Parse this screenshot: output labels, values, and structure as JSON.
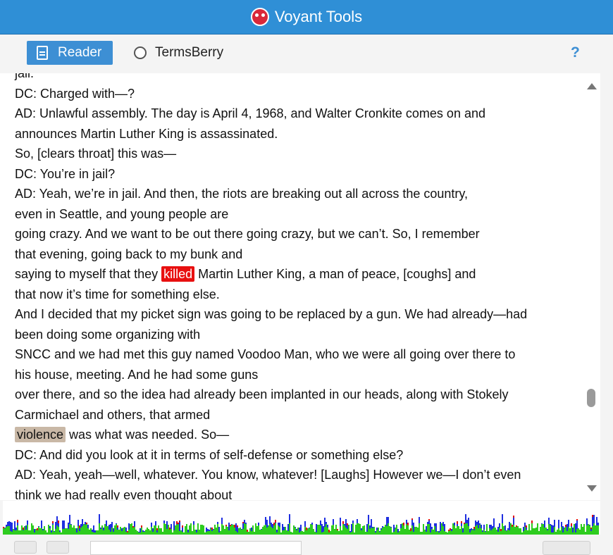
{
  "app": {
    "title": "Voyant Tools"
  },
  "toolbar": {
    "tabs": [
      {
        "label": "Reader",
        "active": true
      },
      {
        "label": "TermsBerry",
        "active": false
      }
    ],
    "help_label": "?"
  },
  "reader": {
    "lines": [
      [
        "jail."
      ],
      [
        "DC: Charged with—?"
      ],
      [
        "AD: Unlawful assembly. The day is April 4, 1968, and Walter Cronkite comes on and"
      ],
      [
        "announces Martin Luther King is assassinated."
      ],
      [
        "So, [clears throat] this was—"
      ],
      [
        "DC: You’re in jail?"
      ],
      [
        "AD: Yeah, we’re in jail. And then, the riots are breaking out all across the country,"
      ],
      [
        "even in Seattle, and young people are"
      ],
      [
        "going crazy. And we want to be out there going crazy, but we can’t. So, I remember"
      ],
      [
        "that evening, going back to my bunk and"
      ],
      [
        "saying to myself that they ",
        "killed",
        " Martin Luther King, a man of peace, [coughs] and"
      ],
      [
        "that now it’s time for something else."
      ],
      [
        "And I decided that my picket sign was going to be replaced by a gun. We had already—had"
      ],
      [
        "been doing some organizing with"
      ],
      [
        "SNCC and we had met this guy named Voodoo Man, who we were all going over there to"
      ],
      [
        "his house, meeting. And he had some guns"
      ],
      [
        "over there, and so the idea had already been implanted in our heads, along with Stokely"
      ],
      [
        "Carmichael and others, that armed"
      ],
      [
        "",
        "violence",
        " was what was needed. So—"
      ],
      [
        "DC: And did you look at it in terms of self-defense or something else?"
      ],
      [
        "AD: Yeah, yeah—well, whatever. You know, whatever! [Laughs] However we—I don’t even"
      ],
      [
        "think we had really even thought about"
      ]
    ],
    "highlighted_terms": [
      "killed",
      "violence"
    ]
  },
  "colors": {
    "title_bar": "#2f8fd6",
    "active_tab": "#3d8fd4",
    "highlight_killed": "#e81010",
    "highlight_violence": "#c9b8a6",
    "strip_green": "#2ecc1f",
    "strip_blue": "#1f2fe0",
    "strip_red": "#e01010"
  },
  "icons": {
    "logo": "voyant-logo-icon",
    "reader_tab": "document-icon",
    "terms_tab": "radio-icon",
    "scroll_up": "triangle-up-icon",
    "scroll_down": "triangle-down-icon"
  }
}
